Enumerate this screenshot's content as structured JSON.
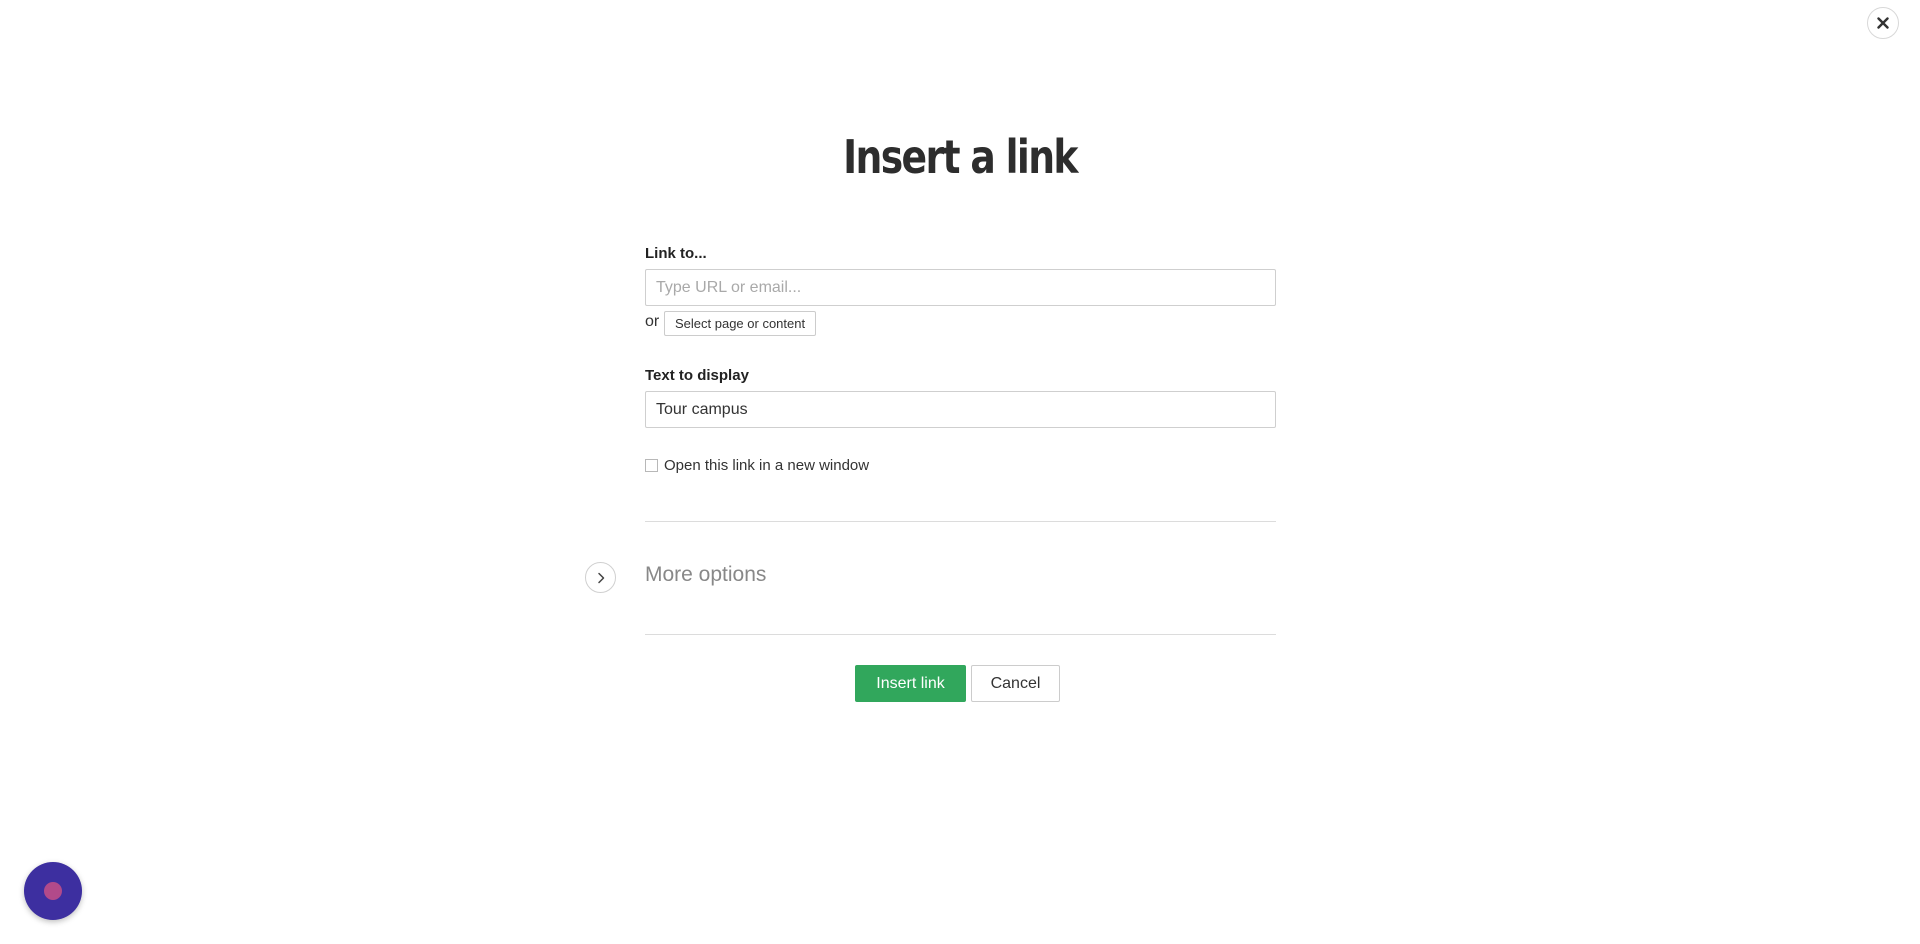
{
  "dialog": {
    "title": "Insert a link",
    "close_icon": "close-icon"
  },
  "link_to": {
    "label": "Link to...",
    "value": "",
    "placeholder": "Type URL or email...",
    "or_text": "or",
    "select_button_label": "Select page or content"
  },
  "display_text": {
    "label": "Text to display",
    "value": "Tour campus"
  },
  "new_window": {
    "label": "Open this link in a new window",
    "checked": false
  },
  "more_options": {
    "label": "More options",
    "icon": "chevron-right-icon"
  },
  "actions": {
    "insert_label": "Insert link",
    "cancel_label": "Cancel"
  },
  "help_widget": {
    "icon": "chat-widget-icon"
  },
  "colors": {
    "primary_button": "#31a75c",
    "widget_background": "#3d2fa0",
    "widget_dot": "#b24a8a"
  }
}
